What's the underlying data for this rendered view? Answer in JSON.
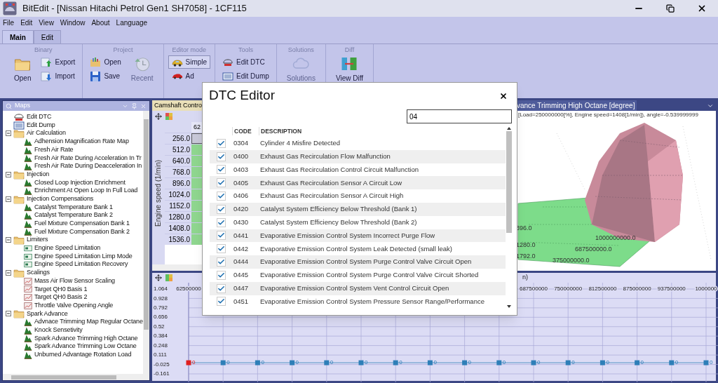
{
  "window": {
    "title": "BitEdit - [Nissan Hitachi Petrol Gen1 SH7058] - 1CF115"
  },
  "menu": [
    "File",
    "Edit",
    "View",
    "Window",
    "About",
    "Language"
  ],
  "ribbon_tabs": [
    {
      "label": "Main",
      "selected": true
    },
    {
      "label": "Edit",
      "selected": false
    }
  ],
  "ribbon_groups": [
    {
      "title": "Binary",
      "columns": [
        [
          {
            "label": "Open",
            "kind": "large",
            "disabled": false
          }
        ],
        [
          {
            "label": "Export",
            "kind": "small",
            "disabled": false
          },
          {
            "label": "Import",
            "kind": "small",
            "disabled": false
          }
        ]
      ]
    },
    {
      "title": "Project",
      "columns": [
        [
          {
            "label": "Open",
            "kind": "small",
            "disabled": false
          },
          {
            "label": "Save",
            "kind": "small",
            "disabled": false
          }
        ],
        [
          {
            "label": "Recent",
            "kind": "large",
            "disabled": true
          }
        ]
      ]
    },
    {
      "title": "Editor mode",
      "columns": [
        [
          {
            "label": "Simple",
            "kind": "small",
            "disabled": false,
            "selected": true
          },
          {
            "label": "Ad",
            "kind": "small",
            "disabled": false,
            "selected": false
          }
        ]
      ]
    },
    {
      "title": "Tools",
      "columns": [
        [
          {
            "label": "Edit DTC",
            "kind": "small",
            "disabled": false
          },
          {
            "label": "Edit Dump",
            "kind": "small",
            "disabled": false
          }
        ]
      ]
    },
    {
      "title": "Solutions",
      "columns": [
        [
          {
            "label": "Solutions",
            "kind": "large",
            "disabled": true
          }
        ]
      ]
    },
    {
      "title": "Diff",
      "columns": [
        [
          {
            "label": "View Diff",
            "kind": "large",
            "disabled": false
          }
        ]
      ]
    }
  ],
  "maps_panel": {
    "title": "Maps",
    "tree": [
      {
        "label": "Edit DTC",
        "kind": "dtc"
      },
      {
        "label": "Edit Dump",
        "kind": "hex"
      },
      {
        "label": "Air Calculation",
        "kind": "folder",
        "expanded": true,
        "children": [
          {
            "label": "Adhension Magnification Rate Map",
            "kind": "map3d"
          },
          {
            "label": "Fresh Air Rate",
            "kind": "map3d"
          },
          {
            "label": "Fresh Air Rate During Acceleration In Tr",
            "kind": "map3d"
          },
          {
            "label": "Fresh Air Rate During Deacceleration In",
            "kind": "map3d"
          }
        ]
      },
      {
        "label": "Injection",
        "kind": "folder",
        "expanded": true,
        "children": [
          {
            "label": "Closed Loop Injection Enrichment",
            "kind": "map3d"
          },
          {
            "label": "Enrichment At Open Loop In Full Load",
            "kind": "map3d"
          }
        ]
      },
      {
        "label": "Injection Compensations",
        "kind": "folder",
        "expanded": true,
        "children": [
          {
            "label": "Catalyst Temperature Bank 1",
            "kind": "map3d"
          },
          {
            "label": "Catalyst Temperature Bank 2",
            "kind": "map3d"
          },
          {
            "label": "Fuel Mixture Compensation Bank 1",
            "kind": "map3d"
          },
          {
            "label": "Fuel Mixture Compensation Bank 2",
            "kind": "map3d"
          }
        ]
      },
      {
        "label": "Limiters",
        "kind": "folder",
        "expanded": true,
        "children": [
          {
            "label": "Engine Speed Limitation",
            "kind": "value"
          },
          {
            "label": "Engine Speed Limitation Limp Mode",
            "kind": "value"
          },
          {
            "label": "Engine Speed Limitation Recovery",
            "kind": "value"
          }
        ]
      },
      {
        "label": "Scalings",
        "kind": "folder",
        "expanded": true,
        "children": [
          {
            "label": "Mass Air Flow Sensor Scaling",
            "kind": "curve"
          },
          {
            "label": "Target QH0 Basis 1",
            "kind": "curve"
          },
          {
            "label": "Target QH0 Basis 2",
            "kind": "curve"
          },
          {
            "label": "Throttle Valve Opening Angle",
            "kind": "curve"
          }
        ]
      },
      {
        "label": "Spark Advance",
        "kind": "folder",
        "expanded": true,
        "children": [
          {
            "label": "Advnace Trimming Map Regular Octane",
            "kind": "map3d"
          },
          {
            "label": "Knock Sensetivity",
            "kind": "map3d"
          },
          {
            "label": "Spark Advance Trimming High Octane",
            "kind": "map3d"
          },
          {
            "label": "Spark Advance Trimming Low Octane",
            "kind": "map3d"
          },
          {
            "label": "Unburned Advantage Rotation Load",
            "kind": "map3d"
          }
        ]
      }
    ]
  },
  "table_panel": {
    "tab": "Camshaft Contro",
    "axis_label": "Engine speed (1/min)",
    "column_header": "62",
    "rows": [
      {
        "label": "256.0",
        "selected": true
      },
      {
        "label": "512.0",
        "selected": false
      },
      {
        "label": "640.0",
        "selected": false
      },
      {
        "label": "768.0",
        "selected": false
      },
      {
        "label": "896.0",
        "selected": false
      },
      {
        "label": "1024.0",
        "selected": false
      },
      {
        "label": "1152.0",
        "selected": false
      },
      {
        "label": "1280.0",
        "selected": false
      },
      {
        "label": "1408.0",
        "selected": false
      },
      {
        "label": "1536.0",
        "selected": false
      }
    ]
  },
  "surface_panel": {
    "tab": "vance Trimming High Octane [degree]",
    "info": "[Load=250000000[%], Engine speed=1408[1/min]), angle=-0.539999999",
    "axis_labels": [
      "396.0",
      "1280.0",
      "1792.0",
      "1000000000.0",
      "687500000.0",
      "375000000.0"
    ]
  },
  "curve_panel": {
    "axis_title": "n)",
    "edge_label": "1000000",
    "points": [
      {
        "selected": true
      },
      {
        "selected": false
      },
      {
        "selected": false
      },
      {
        "selected": false
      },
      {
        "selected": false
      },
      {
        "selected": false
      },
      {
        "selected": false
      },
      {
        "selected": false
      },
      {
        "selected": false
      },
      {
        "selected": false
      },
      {
        "selected": false
      },
      {
        "selected": false
      },
      {
        "selected": false
      },
      {
        "selected": false
      },
      {
        "selected": false
      },
      {
        "selected": false
      }
    ],
    "chart_data": {
      "type": "line",
      "x": [
        62500000,
        125000000,
        187500000,
        250000000,
        312500000,
        375000000,
        437500000,
        500000000,
        562500000,
        625000000,
        687500000,
        750000000,
        812500000,
        875000000,
        937500000,
        1000000000
      ],
      "series": [
        {
          "color": "#2e7fb8",
          "marker": "square",
          "values": [
            0,
            0,
            0,
            0,
            0,
            0,
            0,
            0,
            0,
            0,
            0,
            0,
            0,
            0,
            0,
            0
          ]
        }
      ],
      "xlim": [
        62500000,
        1000000000
      ],
      "xticks": [
        62500000,
        687500000,
        750000000,
        812500000,
        875000000,
        937500000
      ],
      "yticks": [
        1.064,
        0.928,
        0.792,
        0.656,
        0.52,
        0.384,
        0.248,
        0.111,
        -0.025,
        -0.161
      ],
      "ylim": [
        -0.161,
        1.064
      ],
      "grid": true,
      "data_labels": true
    }
  },
  "dialog": {
    "title": "DTC Editor",
    "search": {
      "value": "04"
    },
    "columns": [
      "CODE",
      "DESCRIPTION"
    ],
    "rows": [
      {
        "code": "0304",
        "description": "Cylinder 4 Misfire Detected",
        "checked": true
      },
      {
        "code": "0400",
        "description": "Exhaust Gas Recirculation Flow Malfunction",
        "checked": true
      },
      {
        "code": "0403",
        "description": "Exhaust Gas Recirculation Control Circuit Malfunction",
        "checked": true
      },
      {
        "code": "0405",
        "description": "Exhaust Gas Recirculation Sensor A Circuit Low",
        "checked": true
      },
      {
        "code": "0406",
        "description": "Exhaust Gas Recirculation Sensor A Circuit High",
        "checked": true
      },
      {
        "code": "0420",
        "description": "Catalyst System Efficiency Below Threshold (Bank 1)",
        "checked": true
      },
      {
        "code": "0430",
        "description": "Catalyst System Efficiency Below Threshold (Bank 2)",
        "checked": true
      },
      {
        "code": "0441",
        "description": "Evaporative Emission Control System Incorrect Purge Flow",
        "checked": true
      },
      {
        "code": "0442",
        "description": "Evaporative Emission Control System Leak Detected (small leak)",
        "checked": true
      },
      {
        "code": "0444",
        "description": "Evaporative Emission Control System Purge Control Valve Circuit Open",
        "checked": true
      },
      {
        "code": "0445",
        "description": "Evaporative Emission Control System Purge Control Valve Circuit Shorted",
        "checked": true
      },
      {
        "code": "0447",
        "description": "Evaporative Emission Control System Vent Control Circuit Open",
        "checked": true
      },
      {
        "code": "0451",
        "description": "Evaporative Emission Control System Pressure Sensor Range/Performance",
        "checked": true
      }
    ]
  }
}
